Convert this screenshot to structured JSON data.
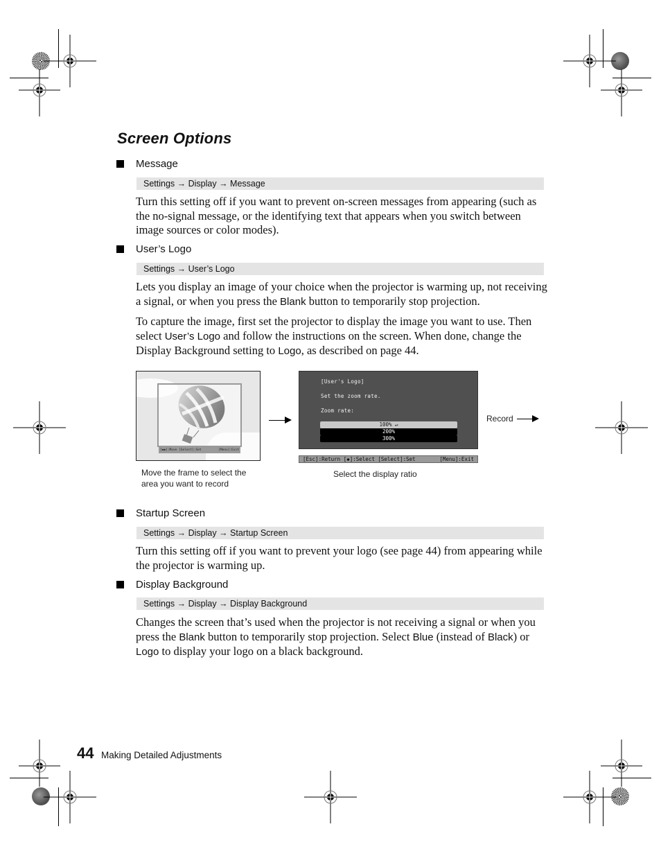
{
  "page": {
    "title": "Screen Options",
    "sections": [
      {
        "heading": "Message",
        "path": "Settings → Display → Message",
        "paragraphs": [
          "Turn this setting off if you want to prevent on-screen messages from appearing (such as the no-signal message, or the identifying text that appears when you switch between image sources or color modes)."
        ]
      },
      {
        "heading": "User’s Logo",
        "path": "Settings → User’s Logo",
        "p1": {
          "before": "Lets you display an image of your choice when the projector is warming up, not receiving a signal, or when you press the ",
          "kw": "Blank",
          "after": " button to temporarily stop projection."
        },
        "p2": {
          "a": "To capture the image, first set the projector to display the image you want to use. Then select ",
          "kw1": "User’s Logo",
          "b": " and follow the instructions on the screen. When done, change the Display Background setting to ",
          "kw2": "Logo",
          "c": ", as described on page 44."
        }
      },
      {
        "heading": "Startup Screen",
        "path": "Settings → Display → Startup Screen",
        "paragraphs": [
          "Turn this setting off if you want to prevent your logo (see page 44) from appearing while the projector is warming up."
        ]
      },
      {
        "heading": "Display Background",
        "path": "Settings → Display → Display Background",
        "p1": {
          "a": "Changes the screen that’s used when the projector is not receiving a signal or when you press the ",
          "kw1": "Blank",
          "b": " button to temporarily stop projection. Select ",
          "kw2": "Blue",
          "c": " (instead of ",
          "kw3": "Black",
          "d": ") or ",
          "kw4": "Logo",
          "e": " to display your logo on a black background."
        }
      }
    ],
    "figure": {
      "left_caption_line1": "Move the frame to select the",
      "left_caption_line2": "area you want to record",
      "left_status_left": "[◆◆]:Move [Select]:Set",
      "left_status_right": "[Menu]:Exit",
      "osd_title": "[User's Logo]",
      "osd_instruction": "Set the zoom rate.",
      "osd_label": "Zoom rate:",
      "osd_options": [
        "100%",
        "200%",
        "300%"
      ],
      "osd_selected_index": 0,
      "osd_status_left": "[Esc]:Return [◆]:Select [Select]:Set",
      "osd_status_right": "[Menu]:Exit",
      "right_caption": "Select the display ratio",
      "record_label": "Record"
    },
    "footer": {
      "page_number": "44",
      "chapter": "Making Detailed Adjustments"
    }
  }
}
